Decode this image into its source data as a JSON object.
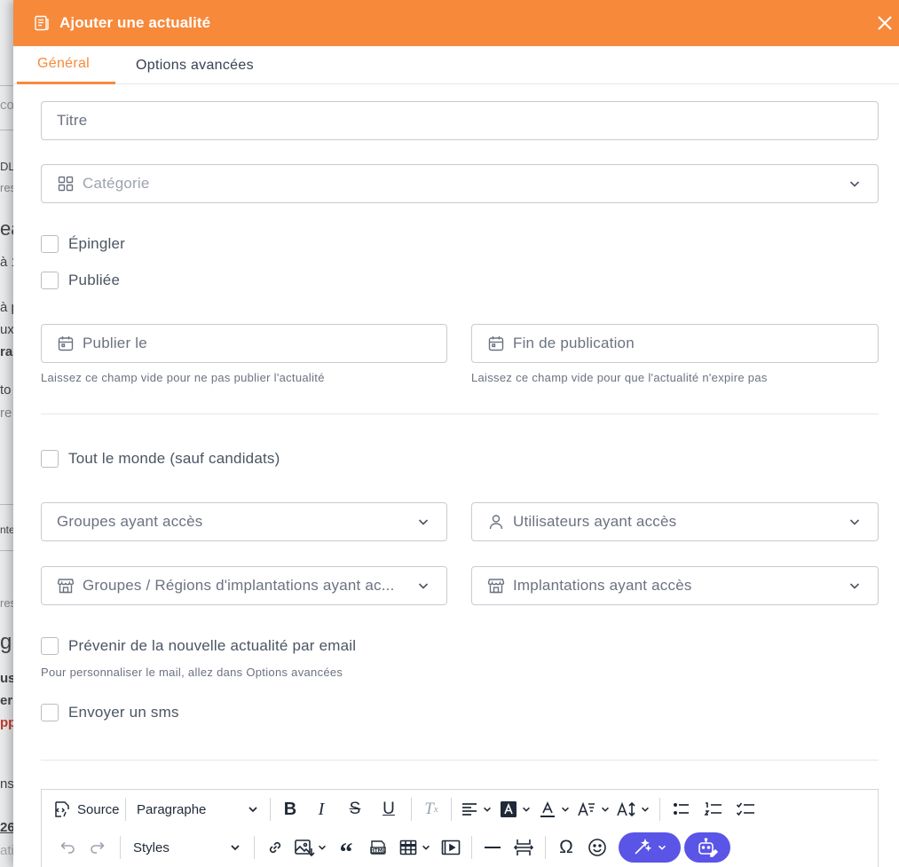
{
  "modal": {
    "title": "Ajouter une actualité"
  },
  "tabs": [
    {
      "label": "Général"
    },
    {
      "label": "Options avancées"
    }
  ],
  "form": {
    "title_placeholder": "Titre",
    "category_placeholder": "Catégorie",
    "pin_label": "Épingler",
    "published_label": "Publiée",
    "publish_date_placeholder": "Publier le",
    "publish_date_help": "Laissez ce champ vide pour ne pas publier l'actualité",
    "end_date_placeholder": "Fin de publication",
    "end_date_help": "Laissez ce champ vide pour que l'actualité n'expire pas",
    "everyone_label": "Tout le monde (sauf candidats)",
    "groups_placeholder": "Groupes ayant accès",
    "users_placeholder": "Utilisateurs ayant accès",
    "region_groups_placeholder": "Groupes / Régions d'implantations ayant ac...",
    "locations_placeholder": "Implantations ayant accès",
    "notify_email_label": "Prévenir de la nouvelle actualité par email",
    "notify_email_help": "Pour personnaliser le mail, allez dans Options avancées",
    "send_sms_label": "Envoyer un sms"
  },
  "editor": {
    "source_label": "Source",
    "paragraph_label": "Paragraphe",
    "styles_label": "Styles"
  },
  "background": {
    "fragments": [
      "co",
      "DL",
      "res",
      "ea",
      "à 1",
      "à p",
      "ux",
      "rai",
      "to",
      "re",
      "nte",
      "res",
      "g",
      "us",
      "er",
      "pp",
      "ns",
      "26",
      "ati"
    ]
  },
  "colors": {
    "accent": "#f7893b",
    "ai_button": "#5a55e6",
    "border": "#c7cbd1"
  }
}
